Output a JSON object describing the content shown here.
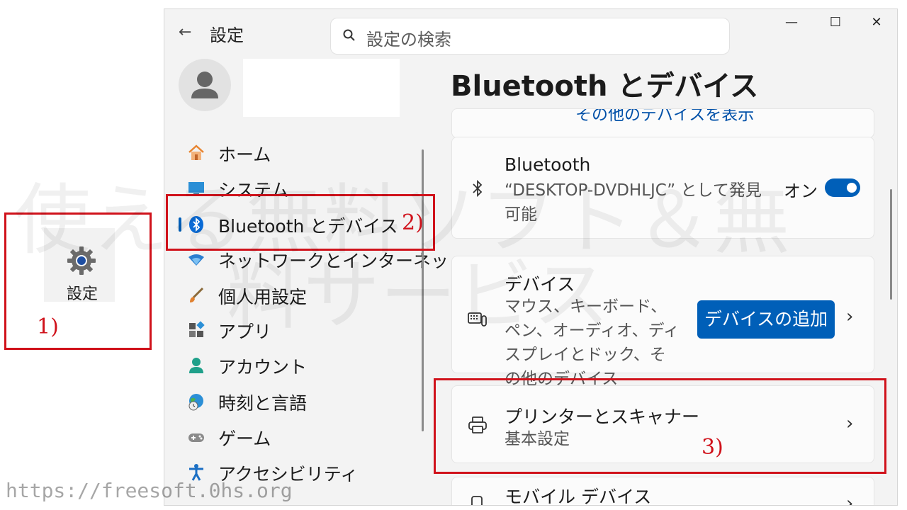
{
  "desktop": {
    "shortcut_label": "設定",
    "annotation_1": "1)"
  },
  "window": {
    "title": "設定",
    "search_placeholder": "設定の検索",
    "controls": {
      "minimize": "—",
      "maximize": "☐",
      "close": "✕"
    }
  },
  "sidebar": {
    "items": [
      {
        "label": "ホーム",
        "icon": "home-icon"
      },
      {
        "label": "システム",
        "icon": "system-icon"
      },
      {
        "label": "Bluetooth とデバイス",
        "icon": "bluetooth-icon",
        "selected": true
      },
      {
        "label": "ネットワークとインターネッ",
        "icon": "wifi-icon"
      },
      {
        "label": "個人用設定",
        "icon": "brush-icon"
      },
      {
        "label": "アプリ",
        "icon": "apps-icon"
      },
      {
        "label": "アカウント",
        "icon": "person-icon"
      },
      {
        "label": "時刻と言語",
        "icon": "globe-clock-icon"
      },
      {
        "label": "ゲーム",
        "icon": "gamepad-icon"
      },
      {
        "label": "アクセシビリティ",
        "icon": "accessibility-icon"
      }
    ],
    "annotation_2": "2)"
  },
  "main": {
    "title": "Bluetooth とデバイス",
    "top_link": "その他のデバイスを表示",
    "bluetooth_card": {
      "title": "Bluetooth",
      "subtitle": "“DESKTOP-DVDHLJC” として発見可能",
      "toggle_label": "オン",
      "toggle_on": true
    },
    "devices_card": {
      "title": "デバイス",
      "subtitle": "マウス、キーボード、ペン、オーディオ、ディスプレイとドック、その他のデバイス",
      "button_label": "デバイスの追加"
    },
    "printers_card": {
      "title": "プリンターとスキャナー",
      "subtitle": "基本設定"
    },
    "mobile_card": {
      "title": "モバイル デバイス"
    },
    "annotation_3": "3)"
  },
  "overlay": {
    "watermark_line1": "使える無料ソフト＆無",
    "watermark_line2": "料サービス",
    "url": "https://freesoft.0hs.org"
  },
  "colors": {
    "accent": "#005fb8",
    "annotation_red": "#d0121b"
  }
}
